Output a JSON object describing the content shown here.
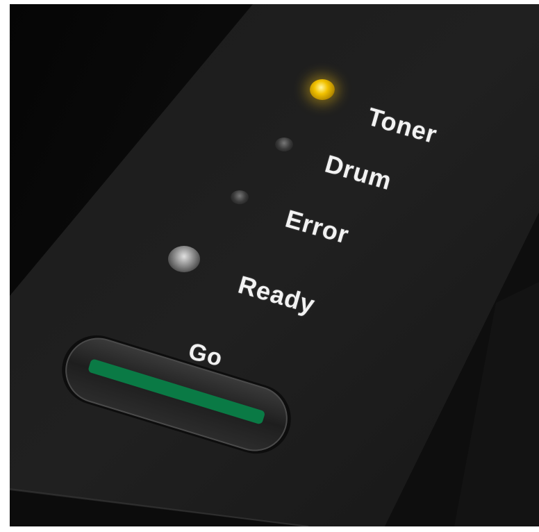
{
  "panel": {
    "indicators": [
      {
        "label": "Toner",
        "state": "lit",
        "color": "#f2c200"
      },
      {
        "label": "Drum",
        "state": "off",
        "color": "#3a3a3a"
      },
      {
        "label": "Error",
        "state": "off",
        "color": "#3a3a3a"
      },
      {
        "label": "Ready",
        "state": "off",
        "color": "#9a9a9a"
      }
    ],
    "go_button": {
      "label": "Go",
      "light_color": "#0a7a45"
    }
  }
}
